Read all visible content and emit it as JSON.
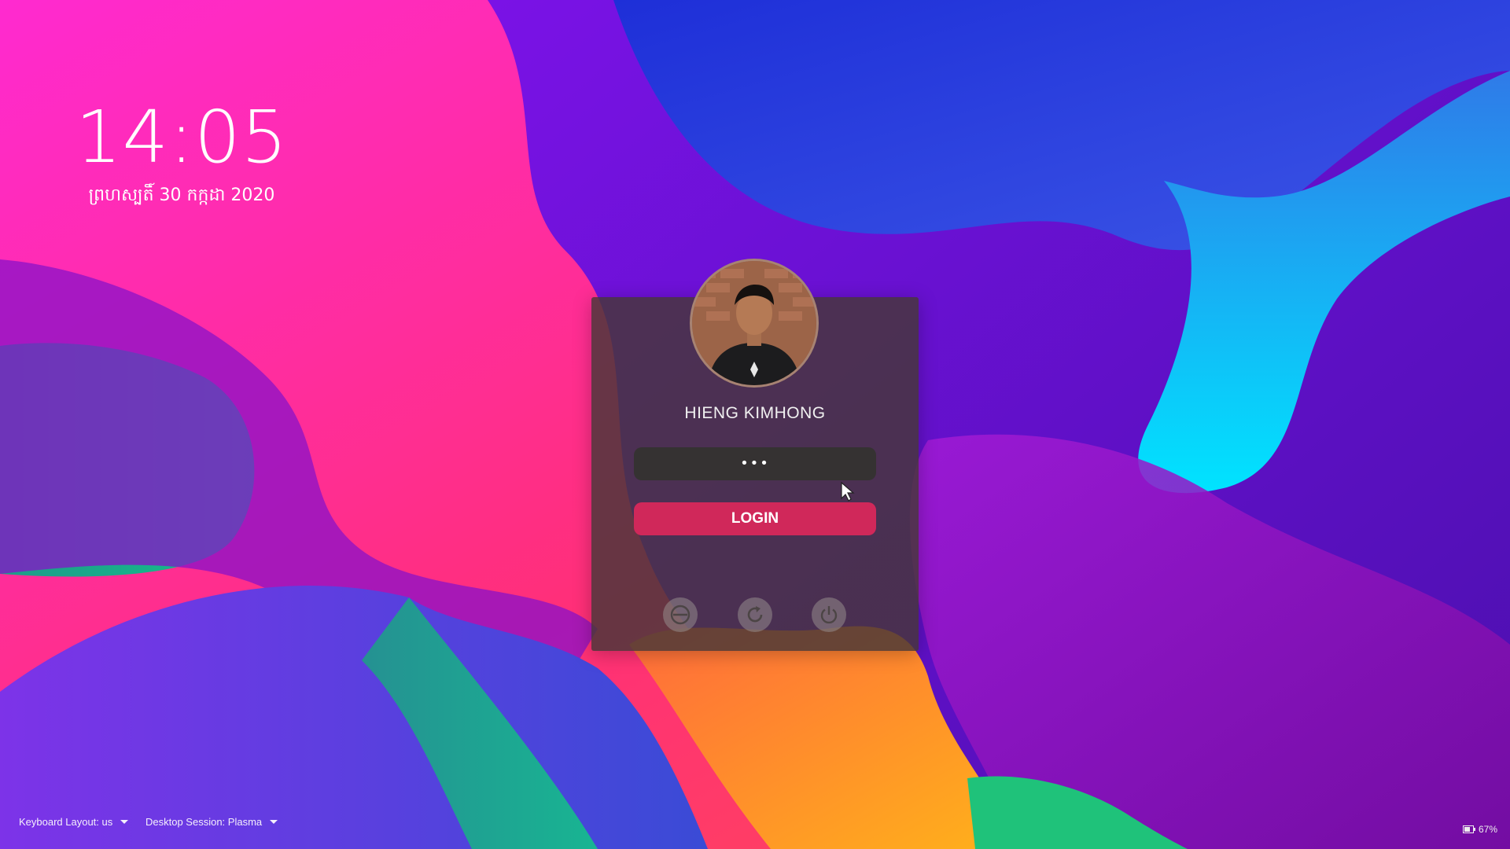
{
  "clock": {
    "time": "14:05",
    "date": "ព្រហស្បតិ៍ 30 កក្កដា 2020"
  },
  "user": {
    "name": "HIENG KIMHONG",
    "avatar_icon": "user-avatar-photo"
  },
  "password": {
    "value": "•••"
  },
  "login": {
    "label": "LOGIN"
  },
  "actions": [
    {
      "icon": "suspend-icon",
      "label": "Suspend"
    },
    {
      "icon": "restart-icon",
      "label": "Restart"
    },
    {
      "icon": "power-icon",
      "label": "Shut Down"
    }
  ],
  "footer": {
    "keyboard_label": "Keyboard Layout: us",
    "session_label": "Desktop Session: Plasma",
    "battery": "67%"
  },
  "colors": {
    "accent": "#d0285a",
    "card": "#463737"
  }
}
